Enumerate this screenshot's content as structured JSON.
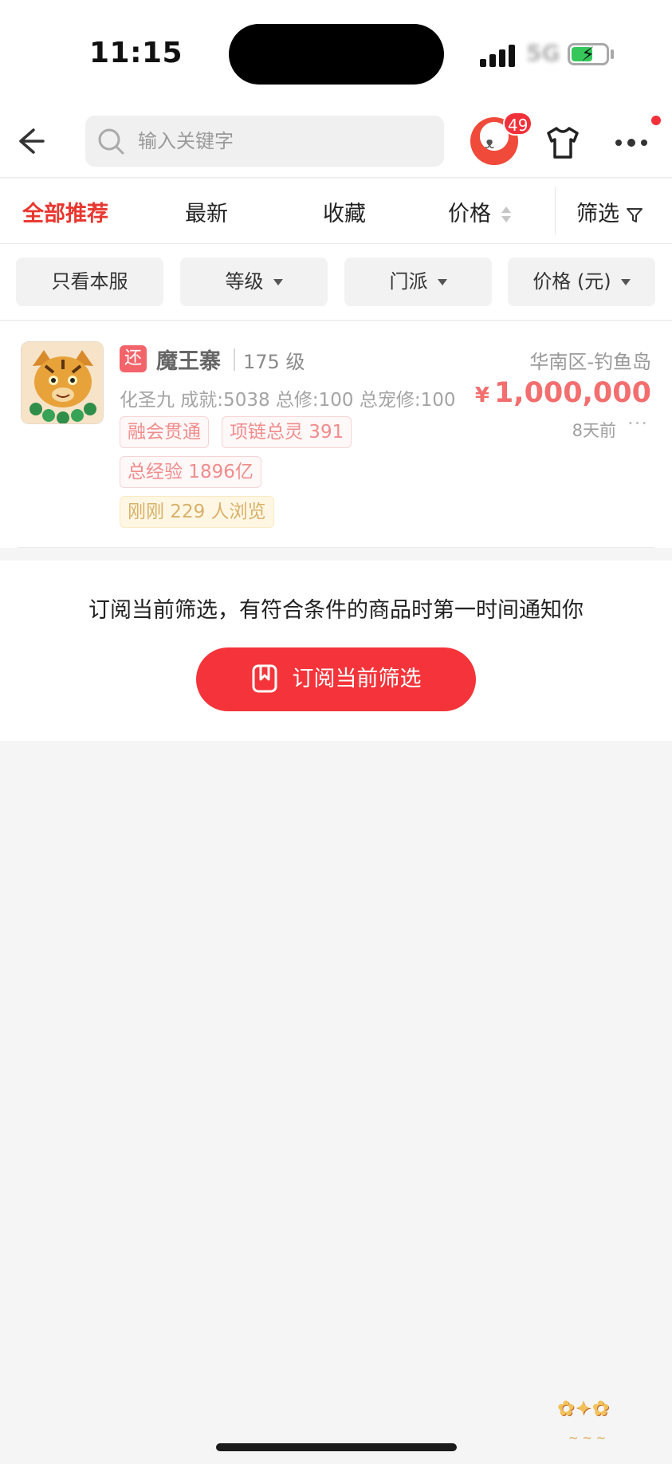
{
  "status_bar": {
    "time": "11:15",
    "network": "5G"
  },
  "nav": {
    "search_placeholder": "输入关键字",
    "notification_count": "49"
  },
  "tabs": [
    {
      "label": "全部推荐",
      "active": true
    },
    {
      "label": "最新",
      "active": false
    },
    {
      "label": "收藏",
      "active": false
    },
    {
      "label": "价格",
      "active": false
    },
    {
      "label": "筛选",
      "active": false
    }
  ],
  "filters": [
    {
      "label": "只看本服",
      "dropdown": false
    },
    {
      "label": "等级",
      "dropdown": true
    },
    {
      "label": "门派",
      "dropdown": true
    },
    {
      "label": "价格 (元)",
      "dropdown": true
    }
  ],
  "listing": {
    "badge": "还",
    "server": "魔王寨",
    "level": "175 级",
    "region": "华南区-钓鱼岛",
    "stats": "化圣九 成就:5038 总修:100 总宠修:100",
    "currency": "¥",
    "price": "1,000,000",
    "time_ago": "8天前",
    "more": "···",
    "tags": [
      "融会贯通",
      "项链总灵 391",
      "总经验 1896亿"
    ],
    "views": "刚刚 229 人浏览"
  },
  "subscribe": {
    "text": "订阅当前筛选，有符合条件的商品时第一时间通知你",
    "button_label": "订阅当前筛选"
  },
  "colors": {
    "accent": "#e8372f",
    "button": "#f4343a",
    "price": "#f36e6e"
  }
}
